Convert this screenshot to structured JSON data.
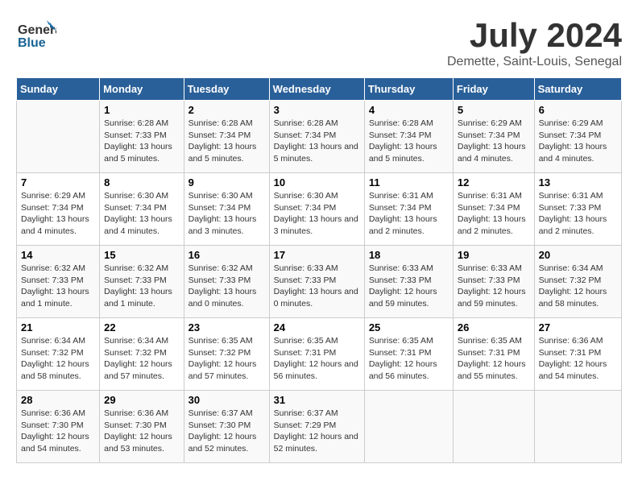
{
  "header": {
    "logo_general": "General",
    "logo_blue": "Blue",
    "month_year": "July 2024",
    "location": "Demette, Saint-Louis, Senegal"
  },
  "weekdays": [
    "Sunday",
    "Monday",
    "Tuesday",
    "Wednesday",
    "Thursday",
    "Friday",
    "Saturday"
  ],
  "weeks": [
    [
      {
        "day": "",
        "sunrise": "",
        "sunset": "",
        "daylight": ""
      },
      {
        "day": "1",
        "sunrise": "Sunrise: 6:28 AM",
        "sunset": "Sunset: 7:33 PM",
        "daylight": "Daylight: 13 hours and 5 minutes."
      },
      {
        "day": "2",
        "sunrise": "Sunrise: 6:28 AM",
        "sunset": "Sunset: 7:34 PM",
        "daylight": "Daylight: 13 hours and 5 minutes."
      },
      {
        "day": "3",
        "sunrise": "Sunrise: 6:28 AM",
        "sunset": "Sunset: 7:34 PM",
        "daylight": "Daylight: 13 hours and 5 minutes."
      },
      {
        "day": "4",
        "sunrise": "Sunrise: 6:28 AM",
        "sunset": "Sunset: 7:34 PM",
        "daylight": "Daylight: 13 hours and 5 minutes."
      },
      {
        "day": "5",
        "sunrise": "Sunrise: 6:29 AM",
        "sunset": "Sunset: 7:34 PM",
        "daylight": "Daylight: 13 hours and 4 minutes."
      },
      {
        "day": "6",
        "sunrise": "Sunrise: 6:29 AM",
        "sunset": "Sunset: 7:34 PM",
        "daylight": "Daylight: 13 hours and 4 minutes."
      }
    ],
    [
      {
        "day": "7",
        "sunrise": "Sunrise: 6:29 AM",
        "sunset": "Sunset: 7:34 PM",
        "daylight": "Daylight: 13 hours and 4 minutes."
      },
      {
        "day": "8",
        "sunrise": "Sunrise: 6:30 AM",
        "sunset": "Sunset: 7:34 PM",
        "daylight": "Daylight: 13 hours and 4 minutes."
      },
      {
        "day": "9",
        "sunrise": "Sunrise: 6:30 AM",
        "sunset": "Sunset: 7:34 PM",
        "daylight": "Daylight: 13 hours and 3 minutes."
      },
      {
        "day": "10",
        "sunrise": "Sunrise: 6:30 AM",
        "sunset": "Sunset: 7:34 PM",
        "daylight": "Daylight: 13 hours and 3 minutes."
      },
      {
        "day": "11",
        "sunrise": "Sunrise: 6:31 AM",
        "sunset": "Sunset: 7:34 PM",
        "daylight": "Daylight: 13 hours and 2 minutes."
      },
      {
        "day": "12",
        "sunrise": "Sunrise: 6:31 AM",
        "sunset": "Sunset: 7:34 PM",
        "daylight": "Daylight: 13 hours and 2 minutes."
      },
      {
        "day": "13",
        "sunrise": "Sunrise: 6:31 AM",
        "sunset": "Sunset: 7:33 PM",
        "daylight": "Daylight: 13 hours and 2 minutes."
      }
    ],
    [
      {
        "day": "14",
        "sunrise": "Sunrise: 6:32 AM",
        "sunset": "Sunset: 7:33 PM",
        "daylight": "Daylight: 13 hours and 1 minute."
      },
      {
        "day": "15",
        "sunrise": "Sunrise: 6:32 AM",
        "sunset": "Sunset: 7:33 PM",
        "daylight": "Daylight: 13 hours and 1 minute."
      },
      {
        "day": "16",
        "sunrise": "Sunrise: 6:32 AM",
        "sunset": "Sunset: 7:33 PM",
        "daylight": "Daylight: 13 hours and 0 minutes."
      },
      {
        "day": "17",
        "sunrise": "Sunrise: 6:33 AM",
        "sunset": "Sunset: 7:33 PM",
        "daylight": "Daylight: 13 hours and 0 minutes."
      },
      {
        "day": "18",
        "sunrise": "Sunrise: 6:33 AM",
        "sunset": "Sunset: 7:33 PM",
        "daylight": "Daylight: 12 hours and 59 minutes."
      },
      {
        "day": "19",
        "sunrise": "Sunrise: 6:33 AM",
        "sunset": "Sunset: 7:33 PM",
        "daylight": "Daylight: 12 hours and 59 minutes."
      },
      {
        "day": "20",
        "sunrise": "Sunrise: 6:34 AM",
        "sunset": "Sunset: 7:32 PM",
        "daylight": "Daylight: 12 hours and 58 minutes."
      }
    ],
    [
      {
        "day": "21",
        "sunrise": "Sunrise: 6:34 AM",
        "sunset": "Sunset: 7:32 PM",
        "daylight": "Daylight: 12 hours and 58 minutes."
      },
      {
        "day": "22",
        "sunrise": "Sunrise: 6:34 AM",
        "sunset": "Sunset: 7:32 PM",
        "daylight": "Daylight: 12 hours and 57 minutes."
      },
      {
        "day": "23",
        "sunrise": "Sunrise: 6:35 AM",
        "sunset": "Sunset: 7:32 PM",
        "daylight": "Daylight: 12 hours and 57 minutes."
      },
      {
        "day": "24",
        "sunrise": "Sunrise: 6:35 AM",
        "sunset": "Sunset: 7:31 PM",
        "daylight": "Daylight: 12 hours and 56 minutes."
      },
      {
        "day": "25",
        "sunrise": "Sunrise: 6:35 AM",
        "sunset": "Sunset: 7:31 PM",
        "daylight": "Daylight: 12 hours and 56 minutes."
      },
      {
        "day": "26",
        "sunrise": "Sunrise: 6:35 AM",
        "sunset": "Sunset: 7:31 PM",
        "daylight": "Daylight: 12 hours and 55 minutes."
      },
      {
        "day": "27",
        "sunrise": "Sunrise: 6:36 AM",
        "sunset": "Sunset: 7:31 PM",
        "daylight": "Daylight: 12 hours and 54 minutes."
      }
    ],
    [
      {
        "day": "28",
        "sunrise": "Sunrise: 6:36 AM",
        "sunset": "Sunset: 7:30 PM",
        "daylight": "Daylight: 12 hours and 54 minutes."
      },
      {
        "day": "29",
        "sunrise": "Sunrise: 6:36 AM",
        "sunset": "Sunset: 7:30 PM",
        "daylight": "Daylight: 12 hours and 53 minutes."
      },
      {
        "day": "30",
        "sunrise": "Sunrise: 6:37 AM",
        "sunset": "Sunset: 7:30 PM",
        "daylight": "Daylight: 12 hours and 52 minutes."
      },
      {
        "day": "31",
        "sunrise": "Sunrise: 6:37 AM",
        "sunset": "Sunset: 7:29 PM",
        "daylight": "Daylight: 12 hours and 52 minutes."
      },
      {
        "day": "",
        "sunrise": "",
        "sunset": "",
        "daylight": ""
      },
      {
        "day": "",
        "sunrise": "",
        "sunset": "",
        "daylight": ""
      },
      {
        "day": "",
        "sunrise": "",
        "sunset": "",
        "daylight": ""
      }
    ]
  ]
}
